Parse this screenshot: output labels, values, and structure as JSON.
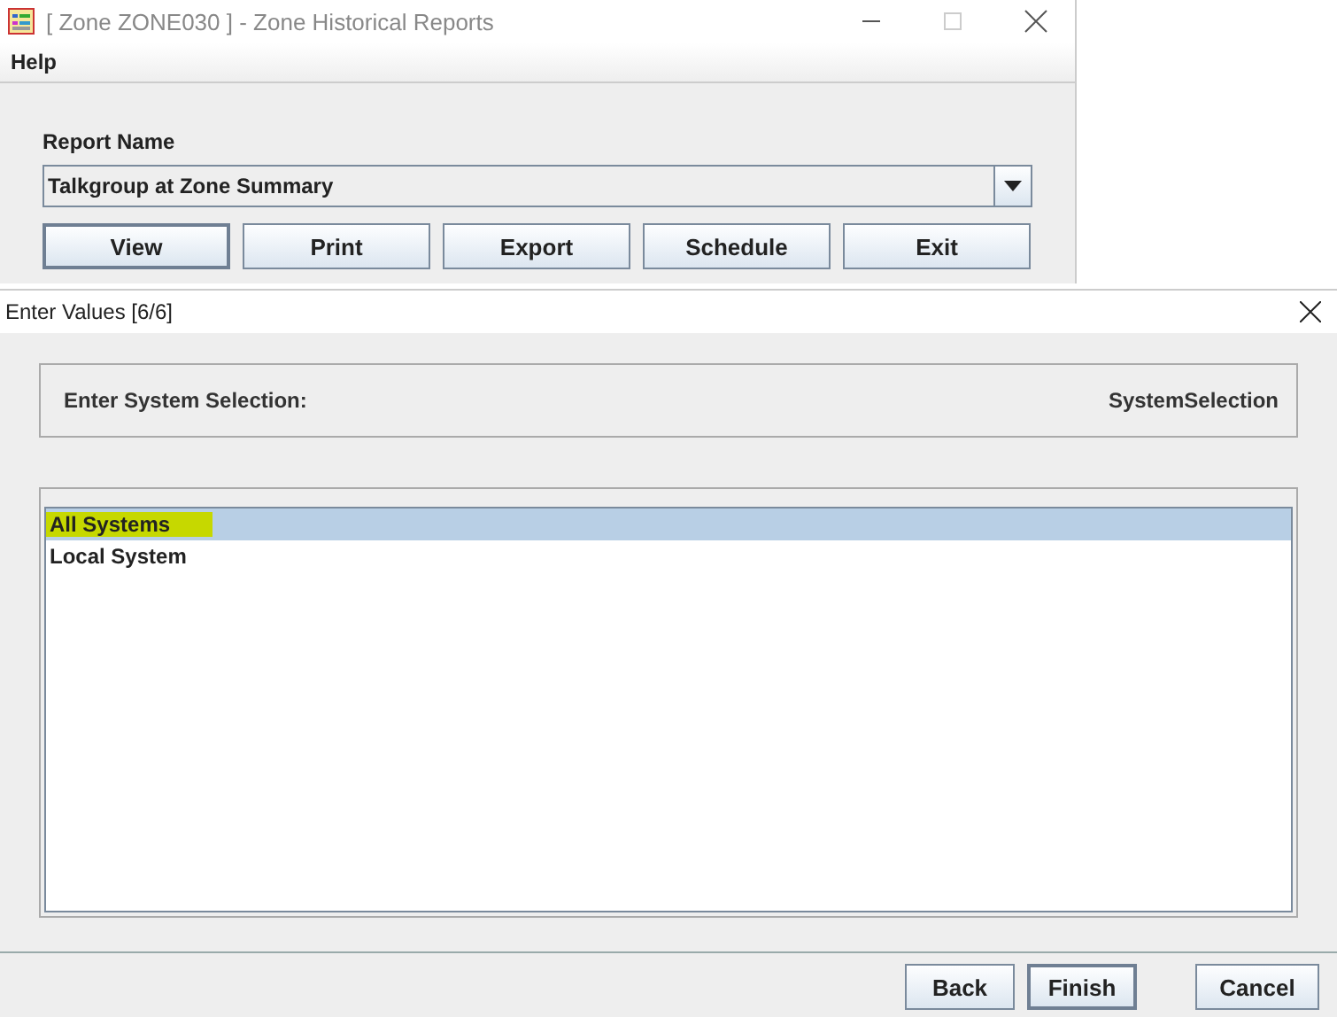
{
  "main_window": {
    "title": "[ Zone ZONE030 ] - Zone Historical Reports",
    "menu": [
      "Help"
    ],
    "report_label": "Report Name",
    "report_value": "Talkgroup at Zone Summary",
    "buttons": [
      {
        "label": "View",
        "focused": true
      },
      {
        "label": "Print",
        "focused": false
      },
      {
        "label": "Export",
        "focused": false
      },
      {
        "label": "Schedule",
        "focused": false
      },
      {
        "label": "Exit",
        "focused": false
      }
    ]
  },
  "dialog": {
    "title": "Enter Values [6/6]",
    "prompt": "Enter System Selection:",
    "parameter": "SystemSelection",
    "items": [
      {
        "label": "All Systems",
        "selected": true,
        "highlighted": true
      },
      {
        "label": "Local System",
        "selected": false,
        "highlighted": false
      }
    ],
    "buttons": [
      {
        "label": "Back",
        "focused": false
      },
      {
        "label": "Finish",
        "focused": true
      },
      {
        "label": "Cancel",
        "focused": false
      }
    ]
  }
}
